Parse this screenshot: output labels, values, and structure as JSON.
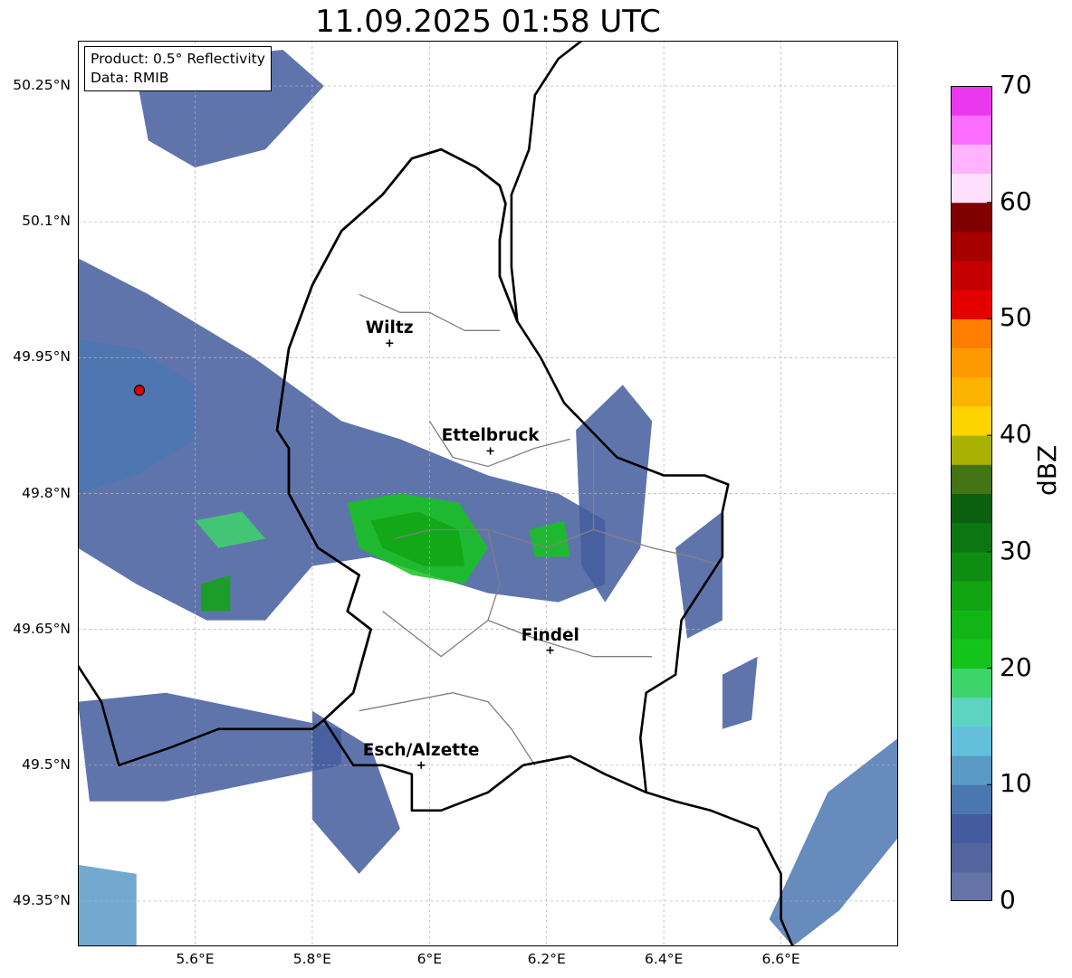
{
  "title": "11.09.2025 01:58 UTC",
  "info": {
    "product": "Product: 0.5° Reflectivity",
    "source": "Data: RMIB"
  },
  "map": {
    "lon_range": [
      5.4,
      6.8
    ],
    "lat_range": [
      49.3,
      50.3
    ],
    "lat_ticks": [
      {
        "value": 50.25,
        "label": "50.25°N"
      },
      {
        "value": 50.1,
        "label": "50.1°N"
      },
      {
        "value": 49.95,
        "label": "49.95°N"
      },
      {
        "value": 49.8,
        "label": "49.8°N"
      },
      {
        "value": 49.65,
        "label": "49.65°N"
      },
      {
        "value": 49.5,
        "label": "49.5°N"
      },
      {
        "value": 49.35,
        "label": "49.35°N"
      }
    ],
    "lon_ticks": [
      {
        "value": 5.6,
        "label": "5.6°E"
      },
      {
        "value": 5.8,
        "label": "5.8°E"
      },
      {
        "value": 6.0,
        "label": "6°E"
      },
      {
        "value": 6.2,
        "label": "6.2°E"
      },
      {
        "value": 6.4,
        "label": "6.4°E"
      },
      {
        "value": 6.6,
        "label": "6.6°E"
      }
    ],
    "radar_site": {
      "lon": 5.505,
      "lat": 49.914,
      "color": "#e00000"
    },
    "cities": [
      {
        "name": "Wiltz",
        "lon": 5.932,
        "lat": 49.966
      },
      {
        "name": "Ettelbruck",
        "lon": 6.104,
        "lat": 49.847
      },
      {
        "name": "Findel",
        "lon": 6.206,
        "lat": 49.627
      },
      {
        "name": "Esch/Alzette",
        "lon": 5.986,
        "lat": 49.5
      }
    ],
    "border_color": "#000000",
    "canton_color": "#808080",
    "grid_color": "#b0b0b0"
  },
  "colorbar": {
    "label": "dBZ",
    "min": 0,
    "max": 70,
    "step": 2.5,
    "ticks": [
      {
        "value": 0,
        "label": "0"
      },
      {
        "value": 10,
        "label": "10"
      },
      {
        "value": 20,
        "label": "20"
      },
      {
        "value": 30,
        "label": "30"
      },
      {
        "value": 40,
        "label": "40"
      },
      {
        "value": 50,
        "label": "50"
      },
      {
        "value": 60,
        "label": "60"
      },
      {
        "value": 70,
        "label": "70"
      }
    ],
    "colors": [
      "#6574a7",
      "#53659c",
      "#445c9e",
      "#4b77b0",
      "#5a9ac5",
      "#63bfdb",
      "#5dd3c2",
      "#3ed46c",
      "#14c41b",
      "#12b516",
      "#11a413",
      "#0f8d12",
      "#0c7611",
      "#0b600f",
      "#447413",
      "#a9b103",
      "#fed400",
      "#fcb300",
      "#fe9a01",
      "#fe7f00",
      "#e50000",
      "#c50000",
      "#a60000",
      "#800000",
      "#fee0fe",
      "#ffb2fe",
      "#fc6cfe",
      "#ea38ee"
    ]
  },
  "echo_regions": [
    {
      "poly": [
        [
          5.4,
          50.06
        ],
        [
          5.52,
          50.02
        ],
        [
          5.7,
          49.95
        ],
        [
          5.85,
          49.88
        ],
        [
          5.95,
          49.86
        ],
        [
          6.1,
          49.82
        ],
        [
          6.22,
          49.8
        ],
        [
          6.3,
          49.77
        ],
        [
          6.3,
          49.7
        ],
        [
          6.22,
          49.68
        ],
        [
          6.1,
          49.69
        ],
        [
          6.0,
          49.71
        ],
        [
          5.9,
          49.73
        ],
        [
          5.8,
          49.72
        ],
        [
          5.72,
          49.66
        ],
        [
          5.62,
          49.66
        ],
        [
          5.5,
          49.7
        ],
        [
          5.4,
          49.74
        ]
      ],
      "dbz": 7
    },
    {
      "poly": [
        [
          5.4,
          49.97
        ],
        [
          5.5,
          49.96
        ],
        [
          5.6,
          49.92
        ],
        [
          5.6,
          49.86
        ],
        [
          5.5,
          49.82
        ],
        [
          5.4,
          49.8
        ]
      ],
      "dbz": 9
    },
    {
      "poly": [
        [
          5.5,
          50.26
        ],
        [
          5.6,
          50.28
        ],
        [
          5.75,
          50.29
        ],
        [
          5.82,
          50.25
        ],
        [
          5.72,
          50.18
        ],
        [
          5.6,
          50.16
        ],
        [
          5.52,
          50.19
        ]
      ],
      "dbz": 7
    },
    {
      "poly": [
        [
          5.4,
          49.57
        ],
        [
          5.55,
          49.58
        ],
        [
          5.7,
          49.56
        ],
        [
          5.85,
          49.54
        ],
        [
          5.85,
          49.5
        ],
        [
          5.7,
          49.48
        ],
        [
          5.55,
          49.46
        ],
        [
          5.42,
          49.46
        ]
      ],
      "dbz": 7
    },
    {
      "poly": [
        [
          5.4,
          49.39
        ],
        [
          5.5,
          49.38
        ],
        [
          5.5,
          49.3
        ],
        [
          5.4,
          49.3
        ]
      ],
      "dbz": 10
    },
    {
      "poly": [
        [
          5.8,
          49.56
        ],
        [
          5.9,
          49.52
        ],
        [
          5.95,
          49.43
        ],
        [
          5.88,
          49.38
        ],
        [
          5.8,
          49.44
        ]
      ],
      "dbz": 7
    },
    {
      "poly": [
        [
          6.68,
          49.47
        ],
        [
          6.8,
          49.53
        ],
        [
          6.8,
          49.42
        ],
        [
          6.7,
          49.34
        ],
        [
          6.62,
          49.3
        ],
        [
          6.58,
          49.33
        ]
      ],
      "dbz": 8
    },
    {
      "poly": [
        [
          6.25,
          49.87
        ],
        [
          6.33,
          49.92
        ],
        [
          6.38,
          49.88
        ],
        [
          6.36,
          49.74
        ],
        [
          6.3,
          49.68
        ],
        [
          6.26,
          49.72
        ]
      ],
      "dbz": 6
    },
    {
      "poly": [
        [
          6.42,
          49.74
        ],
        [
          6.5,
          49.78
        ],
        [
          6.5,
          49.66
        ],
        [
          6.44,
          49.64
        ]
      ],
      "dbz": 5
    },
    {
      "poly": [
        [
          6.5,
          49.6
        ],
        [
          6.56,
          49.62
        ],
        [
          6.55,
          49.55
        ],
        [
          6.5,
          49.54
        ]
      ],
      "dbz": 5
    },
    {
      "poly": [
        [
          5.86,
          49.79
        ],
        [
          5.95,
          49.8
        ],
        [
          6.05,
          49.79
        ],
        [
          6.1,
          49.74
        ],
        [
          6.06,
          49.7
        ],
        [
          5.97,
          49.71
        ],
        [
          5.88,
          49.74
        ]
      ],
      "dbz": 22
    },
    {
      "poly": [
        [
          5.9,
          49.77
        ],
        [
          5.98,
          49.78
        ],
        [
          6.05,
          49.76
        ],
        [
          6.06,
          49.72
        ],
        [
          5.99,
          49.72
        ],
        [
          5.92,
          49.74
        ]
      ],
      "dbz": 27
    },
    {
      "poly": [
        [
          5.6,
          49.77
        ],
        [
          5.68,
          49.78
        ],
        [
          5.72,
          49.75
        ],
        [
          5.64,
          49.74
        ]
      ],
      "dbz": 18
    },
    {
      "poly": [
        [
          5.61,
          49.7
        ],
        [
          5.66,
          49.71
        ],
        [
          5.66,
          49.67
        ],
        [
          5.61,
          49.67
        ]
      ],
      "dbz": 25
    },
    {
      "poly": [
        [
          6.17,
          49.76
        ],
        [
          6.23,
          49.77
        ],
        [
          6.24,
          49.73
        ],
        [
          6.18,
          49.73
        ]
      ],
      "dbz": 20
    }
  ],
  "luxembourg_border": [
    [
      5.97,
      50.17
    ],
    [
      6.02,
      50.18
    ],
    [
      6.08,
      50.16
    ],
    [
      6.12,
      50.14
    ],
    [
      6.13,
      50.12
    ],
    [
      6.12,
      50.08
    ],
    [
      6.12,
      50.04
    ],
    [
      6.15,
      49.99
    ],
    [
      6.19,
      49.95
    ],
    [
      6.23,
      49.9
    ],
    [
      6.32,
      49.84
    ],
    [
      6.4,
      49.82
    ],
    [
      6.47,
      49.82
    ],
    [
      6.51,
      49.81
    ],
    [
      6.5,
      49.78
    ],
    [
      6.5,
      49.73
    ],
    [
      6.43,
      49.66
    ],
    [
      6.42,
      49.6
    ],
    [
      6.37,
      49.58
    ],
    [
      6.36,
      49.53
    ],
    [
      6.37,
      49.47
    ],
    [
      6.3,
      49.49
    ],
    [
      6.24,
      49.51
    ],
    [
      6.16,
      49.5
    ],
    [
      6.1,
      49.47
    ],
    [
      6.02,
      49.45
    ],
    [
      5.97,
      49.45
    ],
    [
      5.97,
      49.49
    ],
    [
      5.92,
      49.5
    ],
    [
      5.87,
      49.5
    ],
    [
      5.82,
      49.55
    ],
    [
      5.87,
      49.58
    ],
    [
      5.9,
      49.65
    ],
    [
      5.86,
      49.67
    ],
    [
      5.88,
      49.71
    ],
    [
      5.81,
      49.74
    ],
    [
      5.76,
      49.8
    ],
    [
      5.76,
      49.85
    ],
    [
      5.74,
      49.87
    ],
    [
      5.76,
      49.96
    ],
    [
      5.8,
      50.03
    ],
    [
      5.85,
      50.09
    ],
    [
      5.92,
      50.13
    ],
    [
      5.97,
      50.17
    ]
  ],
  "belgium_border": [
    [
      5.4,
      49.61
    ],
    [
      5.44,
      49.57
    ],
    [
      5.47,
      49.5
    ],
    [
      5.56,
      49.52
    ],
    [
      5.64,
      49.54
    ],
    [
      5.73,
      49.54
    ],
    [
      5.8,
      49.54
    ],
    [
      5.82,
      49.55
    ],
    [
      5.87,
      49.58
    ],
    [
      5.9,
      49.65
    ],
    [
      5.86,
      49.67
    ],
    [
      5.88,
      49.71
    ],
    [
      5.81,
      49.74
    ],
    [
      5.76,
      49.8
    ],
    [
      5.76,
      49.85
    ],
    [
      5.74,
      49.87
    ],
    [
      5.76,
      49.96
    ],
    [
      5.8,
      50.03
    ],
    [
      5.85,
      50.09
    ],
    [
      5.92,
      50.13
    ],
    [
      5.97,
      50.17
    ],
    [
      6.02,
      50.18
    ],
    [
      6.08,
      50.16
    ],
    [
      6.12,
      50.14
    ],
    [
      6.13,
      50.12
    ],
    [
      6.12,
      50.08
    ],
    [
      6.12,
      50.04
    ],
    [
      6.15,
      49.99
    ],
    [
      6.14,
      50.05
    ],
    [
      6.14,
      50.13
    ],
    [
      6.17,
      50.18
    ],
    [
      6.18,
      50.24
    ],
    [
      6.22,
      50.28
    ],
    [
      6.26,
      50.3
    ]
  ],
  "germany_france_border": [
    [
      6.37,
      49.47
    ],
    [
      6.42,
      49.46
    ],
    [
      6.48,
      49.45
    ],
    [
      6.56,
      49.43
    ],
    [
      6.6,
      49.38
    ],
    [
      6.6,
      49.33
    ],
    [
      6.62,
      49.3
    ]
  ],
  "cantons": [
    [
      [
        5.88,
        50.02
      ],
      [
        5.95,
        50.0
      ],
      [
        6.0,
        50.0
      ],
      [
        6.06,
        49.98
      ],
      [
        6.12,
        49.98
      ]
    ],
    [
      [
        6.0,
        49.88
      ],
      [
        6.04,
        49.84
      ],
      [
        6.1,
        49.83
      ],
      [
        6.18,
        49.85
      ],
      [
        6.24,
        49.86
      ]
    ],
    [
      [
        5.94,
        49.75
      ],
      [
        6.0,
        49.76
      ],
      [
        6.1,
        49.76
      ],
      [
        6.2,
        49.74
      ],
      [
        6.28,
        49.76
      ],
      [
        6.38,
        49.74
      ],
      [
        6.45,
        49.73
      ],
      [
        6.5,
        49.72
      ]
    ],
    [
      [
        5.92,
        49.67
      ],
      [
        6.02,
        49.62
      ],
      [
        6.1,
        49.66
      ],
      [
        6.18,
        49.64
      ],
      [
        6.28,
        49.62
      ],
      [
        6.38,
        49.62
      ]
    ],
    [
      [
        5.88,
        49.56
      ],
      [
        5.96,
        49.57
      ],
      [
        6.04,
        49.58
      ],
      [
        6.1,
        49.57
      ],
      [
        6.14,
        49.54
      ],
      [
        6.18,
        49.5
      ]
    ],
    [
      [
        6.1,
        49.76
      ],
      [
        6.12,
        49.7
      ],
      [
        6.1,
        49.66
      ]
    ],
    [
      [
        6.28,
        49.76
      ],
      [
        6.28,
        49.86
      ]
    ]
  ]
}
